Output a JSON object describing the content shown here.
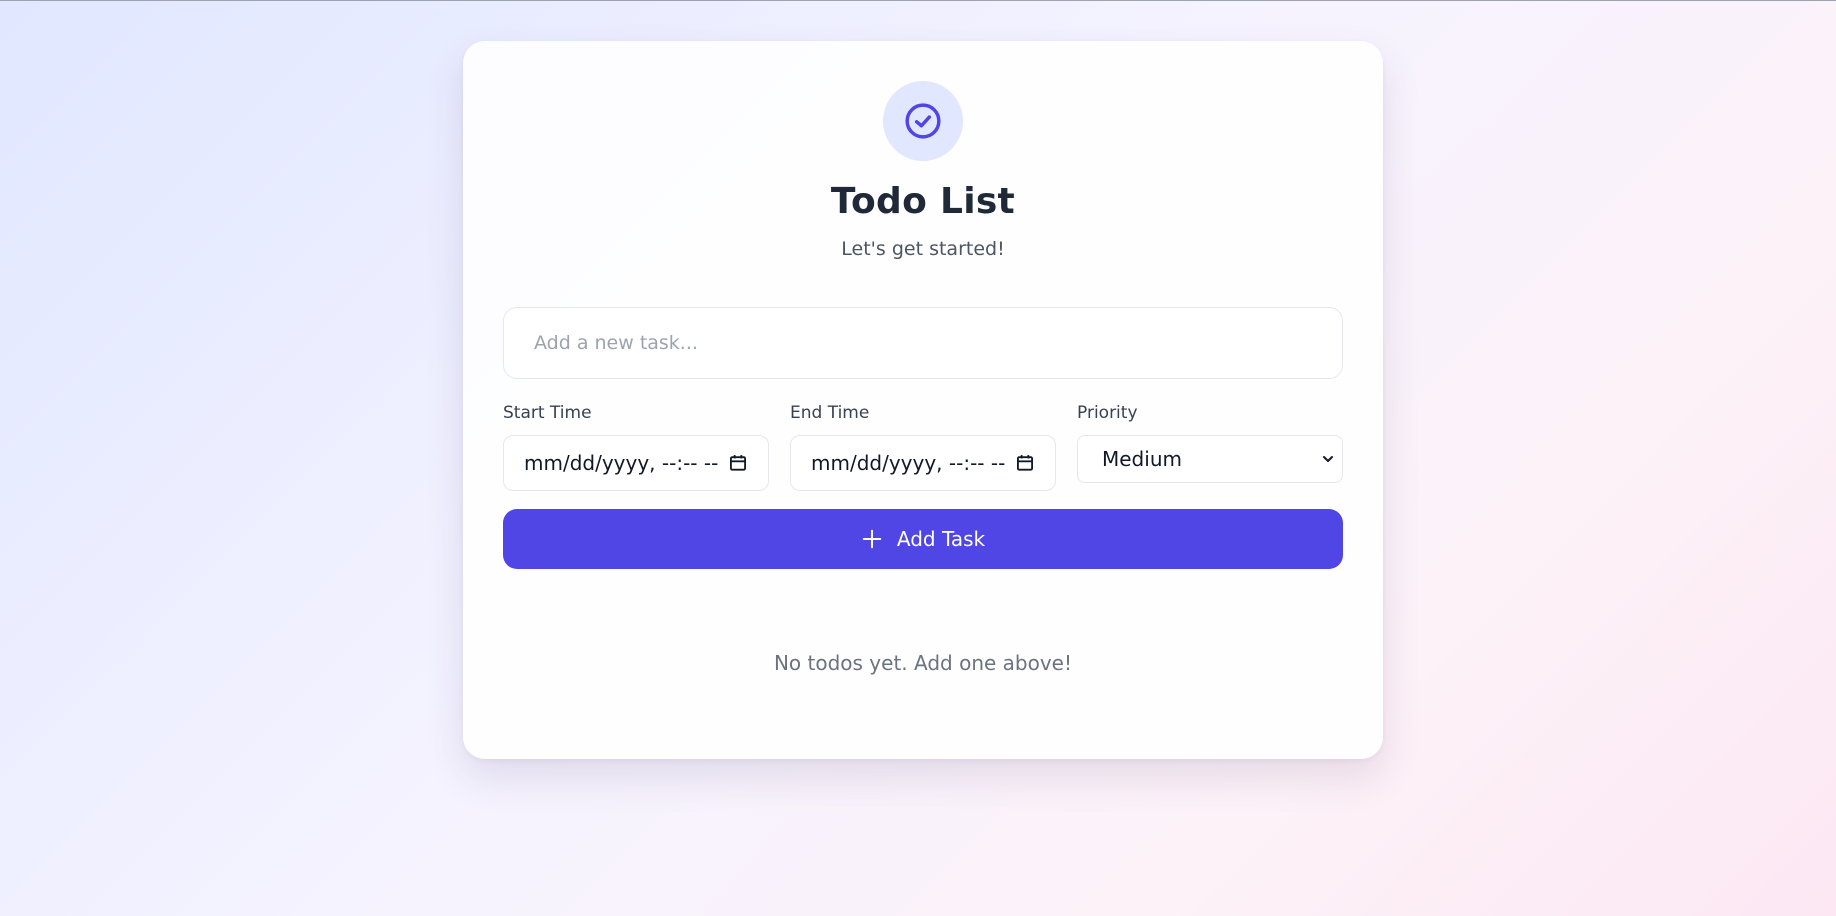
{
  "header": {
    "title": "Todo List",
    "subtitle": "Let's get started!",
    "logo_icon": "check-circle-icon",
    "accent": "#4f46e5"
  },
  "task_input": {
    "placeholder": "Add a new task...",
    "value": ""
  },
  "start_time": {
    "label": "Start Time",
    "value": "mm/dd/yyyy, --:-- --",
    "icon": "calendar-icon"
  },
  "end_time": {
    "label": "End Time",
    "value": "mm/dd/yyyy, --:-- --",
    "icon": "calendar-icon"
  },
  "priority": {
    "label": "Priority",
    "selected": "Medium",
    "icon": "chevron-down-icon"
  },
  "add_button": {
    "label": "Add Task",
    "icon": "plus-icon",
    "color": "#4f46e5"
  },
  "empty_state": {
    "text": "No todos yet. Add one above!"
  }
}
